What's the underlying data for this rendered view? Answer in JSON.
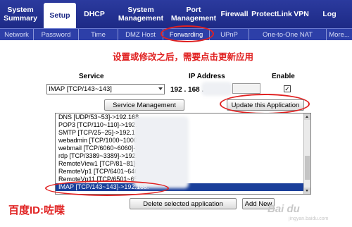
{
  "topnav": {
    "tabs": [
      {
        "label": "System Summary"
      },
      {
        "label": "Setup"
      },
      {
        "label": "DHCP"
      },
      {
        "label": "System Management"
      },
      {
        "label": "Port Management"
      },
      {
        "label": "Firewall"
      },
      {
        "label": "ProtectLink"
      },
      {
        "label": "VPN"
      },
      {
        "label": "Log"
      }
    ]
  },
  "subnav": {
    "items": [
      {
        "label": "Network"
      },
      {
        "label": "Password"
      },
      {
        "label": "Time"
      },
      {
        "label": "DMZ Host"
      },
      {
        "label": "Forwarding"
      },
      {
        "label": "UPnP"
      },
      {
        "label": "One-to-One NAT"
      },
      {
        "label": "More..."
      }
    ]
  },
  "annotation": {
    "top_text": "设置或修改之后，需要点击更新应用",
    "bottom_text": "百度ID:咗喋"
  },
  "form": {
    "service_header": "Service",
    "ip_header": "IP Address",
    "enable_header": "Enable",
    "service_value": "IMAP [TCP/143~143]",
    "ip_prefix": "192 . 168 .",
    "enable_checked": "✓",
    "service_mgmt_button": "Service Management",
    "update_button": "Update this Application"
  },
  "list": {
    "items": [
      "DNS [UDP/53~53]->192.168.",
      "POP3 [TCP/110~110]->192.168.",
      "SMTP [TCP/25~25]->192.1",
      "webadmin [TCP/1000~1000]->",
      "webmail [TCP/6060~6060]->192.",
      "rdp [TCP/3389~3389]->192.168.",
      "RemoteView1 [TCP/81~81]->192.168.",
      "RemoteVp1 [TCP/6401~6401]->192.168.",
      "RemoteVp11 [TCP/6501~6501]->192.168.",
      "IMAP [TCP/143~143]->192.168."
    ]
  },
  "actions": {
    "delete_button": "Delete selected application",
    "add_button": "Add New"
  },
  "watermark": {
    "logo": "Bai du",
    "url": "jingyan.baidu.com"
  },
  "colors": {
    "nav_bg": "#1d2a86",
    "subnav_bg": "#2d3fa8",
    "annotation_red": "#e02020",
    "selection_blue": "#1a3f9a"
  }
}
